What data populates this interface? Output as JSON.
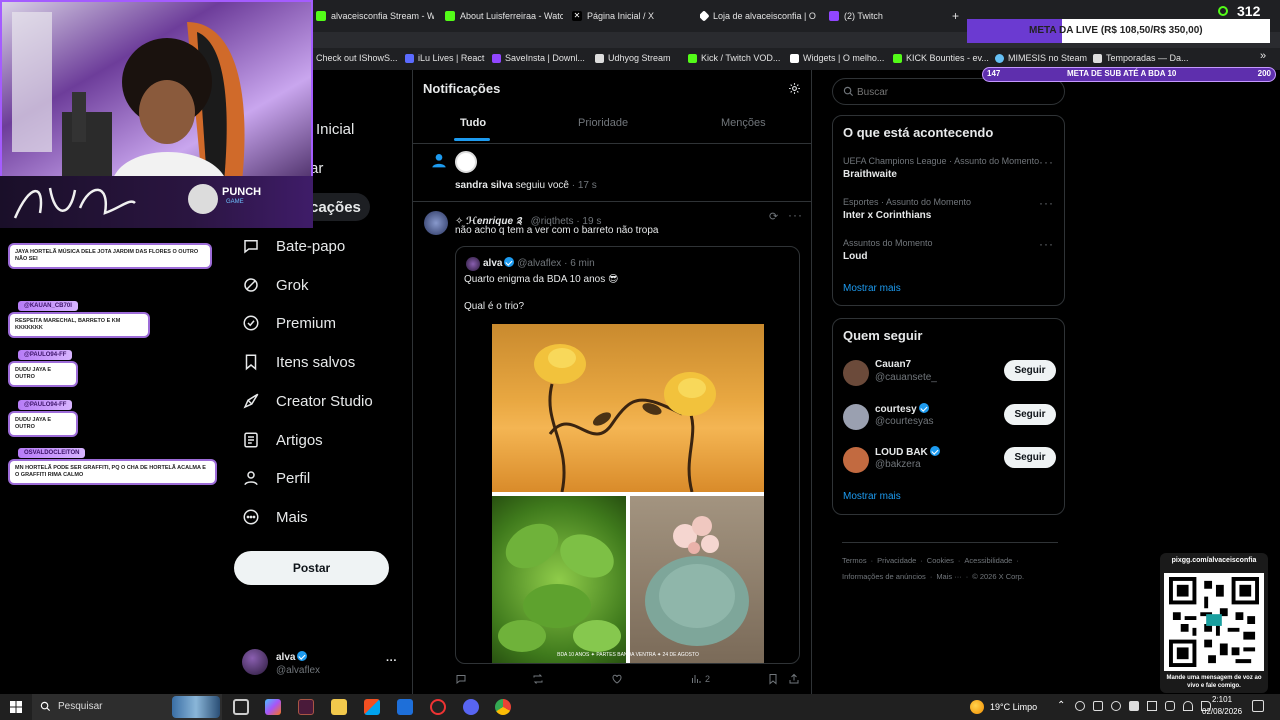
{
  "browser": {
    "tabs": [
      {
        "label": "alvaceisconfia Stream - W",
        "color": "#53fc18"
      },
      {
        "label": "About Luisferreiraa - Watc",
        "color": "#53fc18"
      },
      {
        "label": "Página Inicial / X",
        "color": "#ffffff"
      },
      {
        "label": "Loja de alvaceisconfia | O",
        "color": "#ffffff"
      },
      {
        "label": "(2) Twitch",
        "color": "#9146ff"
      }
    ],
    "new_tab": "+",
    "bookmarks": [
      {
        "label": "Check out IShowS...",
        "color": "#cccccc"
      },
      {
        "label": "iLu Lives | React",
        "color": "#5b6bff"
      },
      {
        "label": "SaveInsta | Downl...",
        "color": "#9146ff"
      },
      {
        "label": "Udhyog Stream",
        "color": "#dddddd"
      },
      {
        "label": "Kick / Twitch VOD...",
        "color": "#53fc18"
      },
      {
        "label": "Widgets | O melho...",
        "color": "#ffffff"
      },
      {
        "label": "KICK Bounties - ev...",
        "color": "#53fc18"
      },
      {
        "label": "MIMESIS no Steam",
        "color": "#66c0f4"
      },
      {
        "label": "Temporadas — Da...",
        "color": "#dddddd"
      }
    ],
    "more_bookmarks": "»"
  },
  "nav": {
    "items": [
      {
        "label": "Inicial",
        "icon": "home-icon"
      },
      {
        "label": "ar",
        "icon": "search-icon"
      },
      {
        "label": "cações",
        "icon": "bell-icon"
      },
      {
        "label": "Bate-papo",
        "icon": "chat-icon"
      },
      {
        "label": "Grok",
        "icon": "grok-icon"
      },
      {
        "label": "Premium",
        "icon": "premium-icon"
      },
      {
        "label": "Itens salvos",
        "icon": "bookmark-icon"
      },
      {
        "label": "Creator Studio",
        "icon": "rocket-icon"
      },
      {
        "label": "Artigos",
        "icon": "article-icon"
      },
      {
        "label": "Perfil",
        "icon": "person-icon"
      },
      {
        "label": "Mais",
        "icon": "more-icon"
      }
    ],
    "post_label": "Postar",
    "account": {
      "name": "alva",
      "handle": "@alvaflex",
      "more": "···"
    }
  },
  "main": {
    "title": "Notificações",
    "tabs": [
      "Tudo",
      "Prioridade",
      "Menções"
    ],
    "follow_notice": {
      "user": "sandra silva",
      "text": " seguiu você",
      "time": "· 17 s"
    },
    "reply": {
      "name": "✧ ℋenrique ༉",
      "handle": "@riqthets",
      "time": "· 19 s",
      "text": "não acho q tem a ver com o barreto não tropa",
      "quoted": {
        "name": "alva",
        "handle": "@alvaflex",
        "time": "· 6 min",
        "line1": "Quarto enigma da BDA 10 anos 😎",
        "line2": "Qual é o trio?",
        "caption": "BDA 10 ANOS   ✦   PARTES BANDA VENTRA   ✦   24 DE AGOSTO"
      },
      "views": "2"
    }
  },
  "right": {
    "search_placeholder": "Buscar",
    "trends_title": "O que está acontecendo",
    "trends": [
      {
        "category": "UEFA Champions League · Assunto do Momento",
        "name": "Braithwaite"
      },
      {
        "category": "Esportes · Assunto do Momento",
        "name": "Inter x Corinthians"
      },
      {
        "category": "Assuntos do Momento",
        "name": "Loud"
      }
    ],
    "show_more": "Mostrar mais",
    "follow_title": "Quem seguir",
    "follow": [
      {
        "name": "Cauan7",
        "handle": "@cauansete_",
        "verified": false,
        "button": "Seguir",
        "color": "#6b4a3a"
      },
      {
        "name": "courtesy",
        "handle": "@courtesyas",
        "verified": true,
        "button": "Seguir",
        "color": "#9aa0b0"
      },
      {
        "name": "LOUD BAK",
        "handle": "@bakzera",
        "verified": true,
        "button": "Seguir",
        "color": "#c26a40"
      }
    ],
    "footer": {
      "line1": [
        "Termos",
        "Privacidade",
        "Cookies",
        "Acessibilidade"
      ],
      "line2": [
        "Informações de anúncios",
        "Mais ···",
        "© 2026 X Corp."
      ]
    }
  },
  "overlay": {
    "sub_count": "312",
    "meta_live": "META DA LIVE (R$ 108,50/R$ 350,00)",
    "meta_sub": {
      "left": "147",
      "label": "META DE SUB ATÉ A BDA 10",
      "right": "200"
    },
    "sponsor": "PUNCH",
    "sponsor_sub": "GAME",
    "chat": [
      {
        "user": "",
        "text": "JAYA HORTELÃ MÚSICA DELE JOTA JARDIM DAS FLORES O OUTRO NÃO SEI"
      },
      {
        "user": "@KAUAN_CB70I",
        "text": "RESPEITA MARECHAL, BARRETO E KM KKKKKKK"
      },
      {
        "user": "@PAULO94-FF",
        "text": "DUDU JAYA E OUTRO"
      },
      {
        "user": "@PAULO94-FF",
        "text": "DUDU JAYA E OUTRO"
      },
      {
        "user": "OSVALDOCLEITON",
        "text": "MN HORTELÃ PODE SER GRAFFITI, PQ O CHA DE HORTELÃ ACALMA E O GRAFFITI RIMA CALMO"
      }
    ],
    "qr_url": "pixgg.com/alvaceisconfia",
    "qr_caption": "Mande uma mensagem de voz ao vivo e fale comigo."
  },
  "taskbar": {
    "search": "Pesquisar",
    "weather": "19°C  Limpo",
    "time": "2:101",
    "date": "02/08/2026"
  }
}
